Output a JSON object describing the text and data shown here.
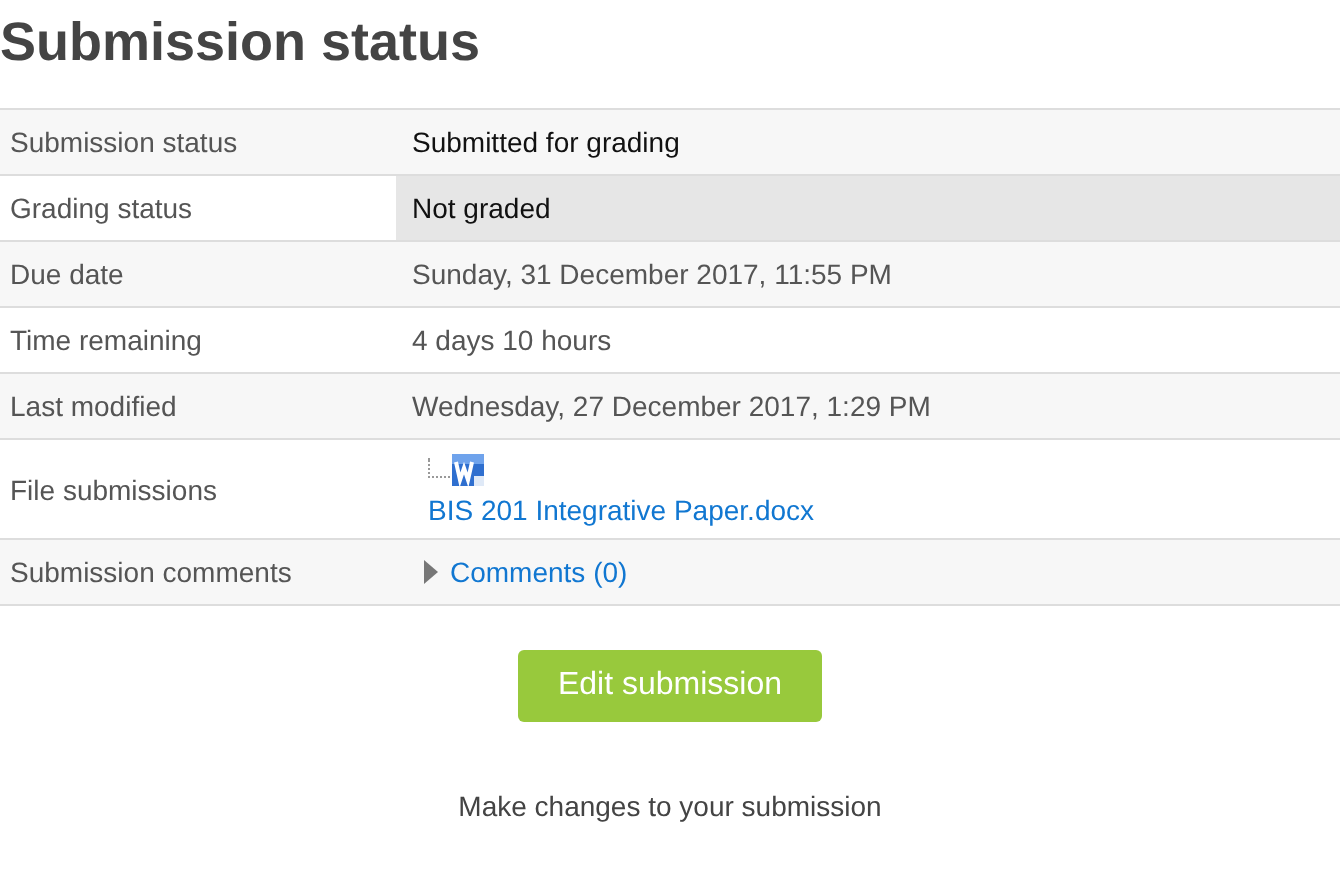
{
  "heading": "Submission status",
  "rows": [
    {
      "label": "Submission status",
      "kind": "status",
      "value": "Submitted for grading",
      "shaded": false
    },
    {
      "label": "Grading status",
      "kind": "status",
      "value": "Not graded",
      "shaded": true
    },
    {
      "label": "Due date",
      "kind": "text",
      "value": "Sunday, 31 December 2017, 11:55 PM"
    },
    {
      "label": "Time remaining",
      "kind": "text",
      "value": "4 days 10 hours"
    },
    {
      "label": "Last modified",
      "kind": "text",
      "value": "Wednesday, 27 December 2017, 1:29 PM"
    },
    {
      "label": "File submissions",
      "kind": "files",
      "files": [
        "BIS 201 Integrative Paper.docx"
      ]
    },
    {
      "label": "Submission comments",
      "kind": "comments",
      "link": "Comments (0)",
      "expanded": false
    }
  ],
  "button": "Edit submission",
  "help": "Make changes to your submission"
}
